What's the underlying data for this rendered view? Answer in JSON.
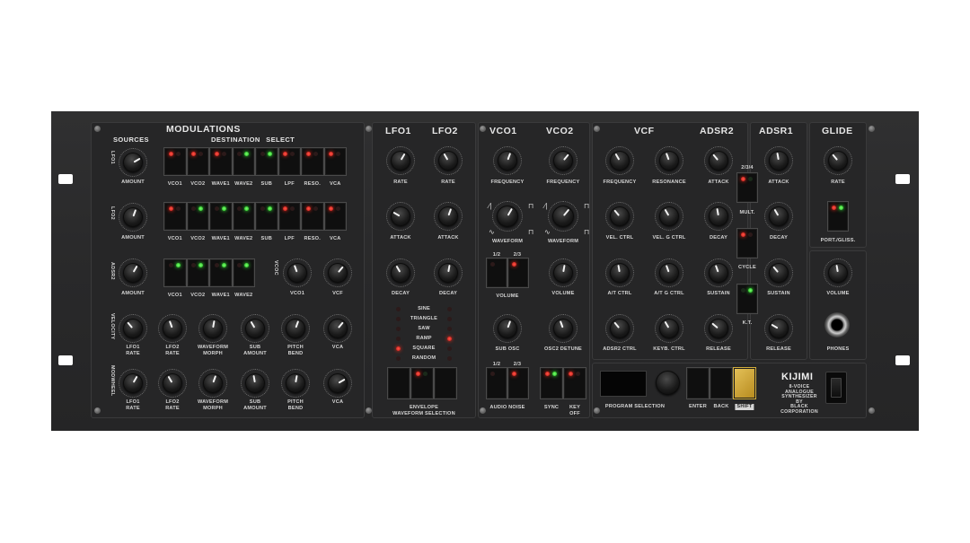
{
  "headers": {
    "modulations": "MODULATIONS",
    "sources": "SOURCES",
    "destination_select": "DESTINATION SELECT",
    "lfo1": "LFO1",
    "lfo2": "LFO2",
    "vco1": "VCO1",
    "vco2": "VCO2",
    "vcf": "VCF",
    "adsr2": "ADSR2",
    "adsr1": "ADSR1",
    "glide": "GLIDE"
  },
  "sources": {
    "lfo1": "LFO1",
    "lfo2": "LFO2",
    "adsr2": "ADSR2",
    "velocity": "VELOCITY",
    "modwheel": "MODWHEEL",
    "vcoc": "VCOC"
  },
  "mod_rows": {
    "amount": "AMOUNT",
    "dest_full": [
      "VCO1",
      "VCO2",
      "WAVE1",
      "WAVE2",
      "SUB",
      "LPF",
      "RESO.",
      "VCA"
    ],
    "row1_leds": [
      [
        "red",
        "off"
      ],
      [
        "red",
        "off"
      ],
      [
        "red",
        "off"
      ],
      [
        "off",
        "green"
      ],
      [
        "off",
        "green"
      ],
      [
        "red",
        "off"
      ],
      [
        "red",
        "off"
      ],
      [
        "red",
        "off"
      ]
    ],
    "row2_leds": [
      [
        "red",
        "off"
      ],
      [
        "off",
        "green"
      ],
      [
        "off",
        "green"
      ],
      [
        "off",
        "green"
      ],
      [
        "off",
        "green"
      ],
      [
        "red",
        "off"
      ],
      [
        "red",
        "off"
      ],
      [
        "red",
        "off"
      ]
    ],
    "row3_leds": [
      [
        "off",
        "green"
      ],
      [
        "off",
        "green"
      ],
      [
        "off",
        "green"
      ],
      [
        "off",
        "green"
      ]
    ],
    "vco1": "VCO1",
    "vcf": "VCF",
    "row4": [
      "LFO1\nRATE",
      "LFO2\nRATE",
      "WAVEFORM\nMORPH",
      "SUB\nAMOUNT",
      "PITCH\nBEND",
      "VCA"
    ],
    "row5": [
      "LFO1\nRATE",
      "LFO2\nRATE",
      "WAVEFORM\nMORPH",
      "SUB\nAMOUNT",
      "PITCH\nBEND",
      "VCA"
    ]
  },
  "lfo": {
    "rate": "RATE",
    "attack": "ATTACK",
    "decay": "DECAY",
    "waves": [
      "SINE",
      "TRIANGLE",
      "SAW",
      "RAMP",
      "SQUARE",
      "RANDOM"
    ],
    "wave_leds_left": [
      "off",
      "off",
      "off",
      "off",
      "red",
      "off"
    ],
    "wave_leds_right": [
      "off",
      "off",
      "off",
      "red",
      "off",
      "off"
    ],
    "env_sel": "ENVELOPE\nWAVEFORM SELECTION"
  },
  "vco": {
    "frequency": "FREQUENCY",
    "waveform": "WAVEFORM",
    "volume": "VOLUME",
    "sub_osc": "SUB OSC",
    "osc2_detune": "OSC2 DETUNE",
    "vol_sel_a": "1/2",
    "vol_sel_b": "2/3",
    "noise_a": "1/2",
    "noise_b": "2/3",
    "audio_noise": "AUDIO NOISE",
    "sync": "SYNC",
    "key_off": "KEY\nOFF"
  },
  "vcf": {
    "frequency": "FREQUENCY",
    "resonance": "RESONANCE",
    "vel_ctrl": "VEL. CTRL",
    "vel_g_ctrl": "VEL. G CTRL",
    "at_ctrl": "A/T CTRL",
    "at_g_ctrl": "A/T G CTRL",
    "adsr2_ctrl": "ADSR2 CTRL",
    "keyb_ctrl": "KEYB. CTRL"
  },
  "adsr2": {
    "attack": "ATTACK",
    "decay": "DECAY",
    "sustain": "SUSTAIN",
    "release": "RELEASE"
  },
  "adsr1": {
    "attack": "ATTACK",
    "decay": "DECAY",
    "sustain": "SUSTAIN",
    "release": "RELEASE",
    "sel234": "2/3/4",
    "mult": "MULT.",
    "cycle": "CYCLE",
    "kt": "K.T."
  },
  "glide": {
    "rate": "RATE",
    "port_gliss": "PORT./GLISS.",
    "volume": "VOLUME",
    "phones": "PHONES"
  },
  "program": {
    "program_selection": "PROGRAM SELECTION",
    "enter": "ENTER",
    "back": "BACK",
    "shift": "SHIFT"
  },
  "brand": {
    "name": "KIJIMI",
    "tagline": "8-VOICE\nANALOGUE\nSYNTHESIZER\nBY\nBLACK\nCORPORATION"
  },
  "colors": {
    "panel": "#2a2a2b",
    "led_red": "#ff3a2a",
    "led_green": "#3aff3a",
    "shift_gold": "#d4a933"
  }
}
